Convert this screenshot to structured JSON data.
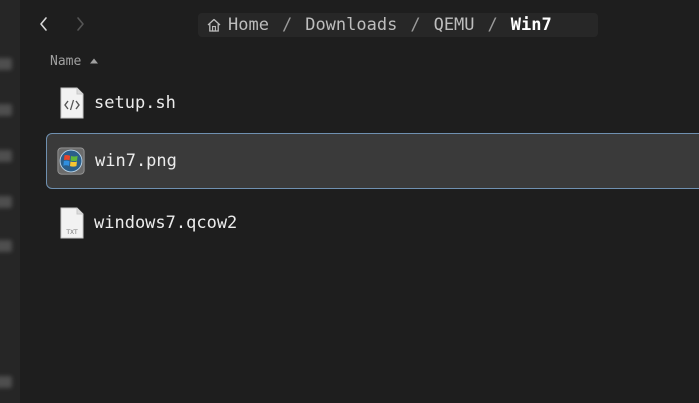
{
  "toolbar": {
    "back_icon": "chevron-left-icon",
    "forward_icon": "chevron-right-icon"
  },
  "breadcrumb": {
    "home_icon": "home-icon",
    "items": [
      "Home",
      "Downloads",
      "QEMU",
      "Win7"
    ],
    "separator": "/"
  },
  "list": {
    "column_header": "Name",
    "sort_icon": "sort-ascending-icon",
    "files": [
      {
        "name": "setup.sh",
        "icon": "script-file-icon",
        "selected": false
      },
      {
        "name": "win7.png",
        "icon": "windows-image-icon",
        "selected": true
      },
      {
        "name": "windows7.qcow2",
        "icon": "text-file-icon",
        "selected": false
      }
    ],
    "text_file_badge": "TXT"
  },
  "colors": {
    "background": "#1e1e1e",
    "selection_bg": "#3a3a3a",
    "selection_border": "#6f90b0",
    "current_crumb": "#ffffff"
  }
}
